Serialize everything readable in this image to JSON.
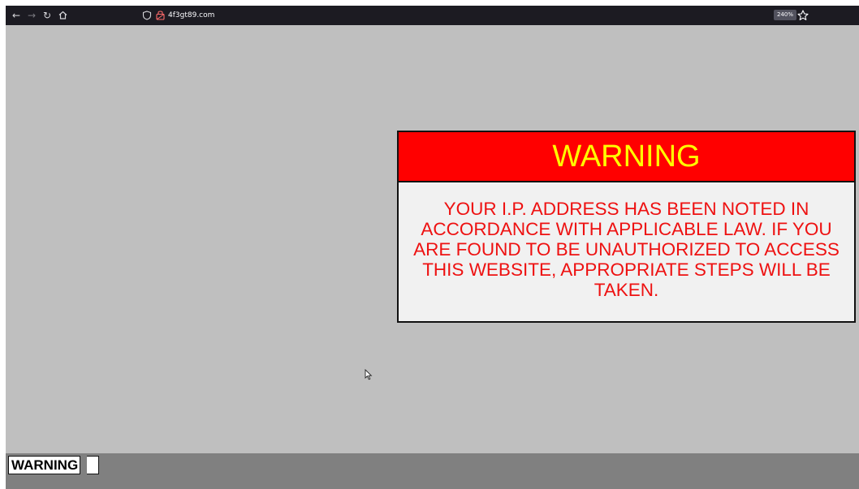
{
  "browser": {
    "url": "4f3gt89.com",
    "zoom": "240%",
    "icons": {
      "back": "back-arrow-icon",
      "forward": "forward-arrow-icon",
      "reload": "reload-icon",
      "home": "home-icon",
      "shield": "shield-icon",
      "lock": "lock-warning-icon",
      "star": "star-icon"
    }
  },
  "warning_box": {
    "heading": "WARNING",
    "message": "YOUR I.P. ADDRESS HAS BEEN NOTED IN ACCORDANCE WITH APPLICABLE LAW.  IF YOU ARE FOUND TO BE UNAUTHORIZED TO ACCESS THIS WEBSITE, APPROPRIATE STEPS WILL BE TAKEN.",
    "heading_bg": "#ff0000",
    "heading_color": "#ffff00",
    "message_color": "#ee1111"
  },
  "bottom_bar": {
    "label": "WARNING"
  },
  "colors": {
    "page_bg": "#bfbfbf",
    "toolbar_bg": "#1c1b22",
    "bottom_bar_bg": "#808080"
  }
}
